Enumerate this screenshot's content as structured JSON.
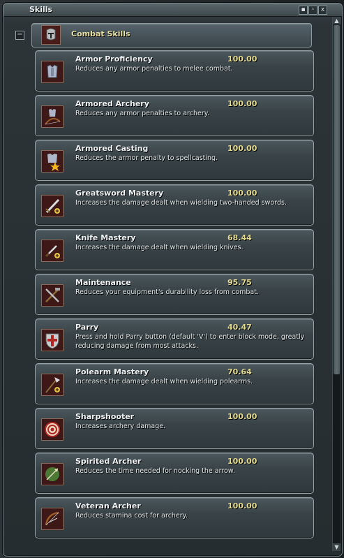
{
  "window": {
    "title": "Skills",
    "buttons": {
      "minimize": "▪",
      "restore": "◦",
      "close": "x"
    }
  },
  "category": {
    "toggle": "−",
    "label": "Combat Skills",
    "icon": "helmet-icon"
  },
  "skills": [
    {
      "name": "Armor Proficiency",
      "value": "100.00",
      "description": "Reduces any armor penalties to melee combat.",
      "icon": "armor-icon"
    },
    {
      "name": "Armored Archery",
      "value": "100.00",
      "description": "Reduces any armor penalties to archery.",
      "icon": "armor-bow-icon"
    },
    {
      "name": "Armored Casting",
      "value": "100.00",
      "description": "Reduces the armor penalty to spellcasting.",
      "icon": "armor-star-icon"
    },
    {
      "name": "Greatsword Mastery",
      "value": "100.00",
      "description": "Increases the damage dealt when wielding two-handed swords.",
      "icon": "greatsword-icon"
    },
    {
      "name": "Knife Mastery",
      "value": "68.44",
      "description": "Increases the damage dealt when wielding knives.",
      "icon": "knife-icon"
    },
    {
      "name": "Maintenance",
      "value": "95.75",
      "description": "Reduces your equipment's durability loss from combat.",
      "icon": "tools-icon"
    },
    {
      "name": "Parry",
      "value": "40.47",
      "description": "Press and hold Parry button (default 'V') to enter block mode, greatly reducing damage from most attacks.",
      "icon": "shield-icon"
    },
    {
      "name": "Polearm Mastery",
      "value": "70.64",
      "description": "Increases the damage dealt when wielding polearms.",
      "icon": "polearm-icon"
    },
    {
      "name": "Sharpshooter",
      "value": "100.00",
      "description": "Increases archery damage.",
      "icon": "target-icon"
    },
    {
      "name": "Spirited Archer",
      "value": "100.00",
      "description": "Reduces the time needed for nocking the arrow.",
      "icon": "arrow-icon"
    },
    {
      "name": "Veteran Archer",
      "value": "100.00",
      "description": "Reduces stamina cost for archery.",
      "icon": "bow-icon"
    }
  ],
  "colors": {
    "skill_name": "#eef2f3",
    "skill_value": "#e3da8e",
    "category_label": "#e6dfa0",
    "icon_bg": "#3e1816"
  }
}
